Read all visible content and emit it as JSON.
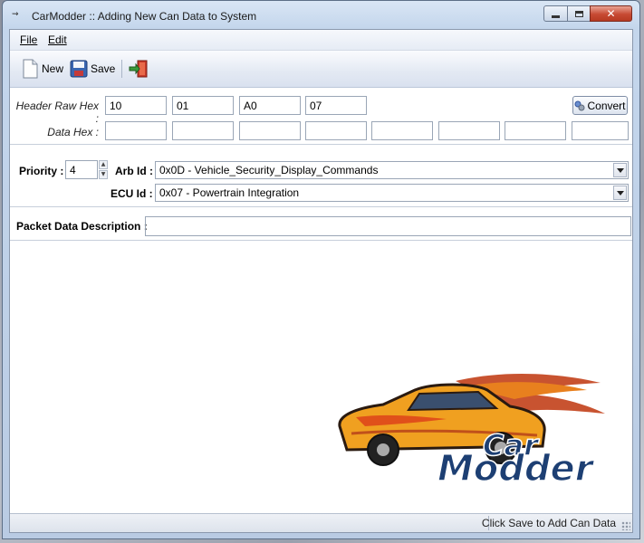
{
  "window": {
    "title": "CarModder :: Adding New Can Data to System",
    "controls": {
      "minimize": "minimize",
      "maximize": "maximize",
      "close": "✕"
    }
  },
  "menu": {
    "file": "File",
    "edit": "Edit"
  },
  "toolbar": {
    "new_label": "New",
    "save_label": "Save"
  },
  "header_raw": {
    "label": "Header Raw Hex :",
    "values": [
      "10",
      "01",
      "A0",
      "07"
    ]
  },
  "data_hex": {
    "label": "Data Hex :",
    "values": [
      "",
      "",
      "",
      "",
      "",
      "",
      "",
      ""
    ]
  },
  "convert_label": "Convert",
  "priority": {
    "label": "Priority :",
    "value": "4"
  },
  "arb_id": {
    "label": "Arb Id :",
    "value": "0x0D - Vehicle_Security_Display_Commands"
  },
  "ecu_id": {
    "label": "ECU Id :",
    "value": "0x07 - Powertrain Integration"
  },
  "description": {
    "label": "Packet Data Description :",
    "value": ""
  },
  "logo": {
    "line1": "Car",
    "line2": "Modder"
  },
  "status": {
    "text": "Click Save to Add Can Data"
  },
  "colors": {
    "accent": "#3a6ea5",
    "logo_orange": "#f0a020",
    "logo_text_blue": "#1d3f73"
  }
}
